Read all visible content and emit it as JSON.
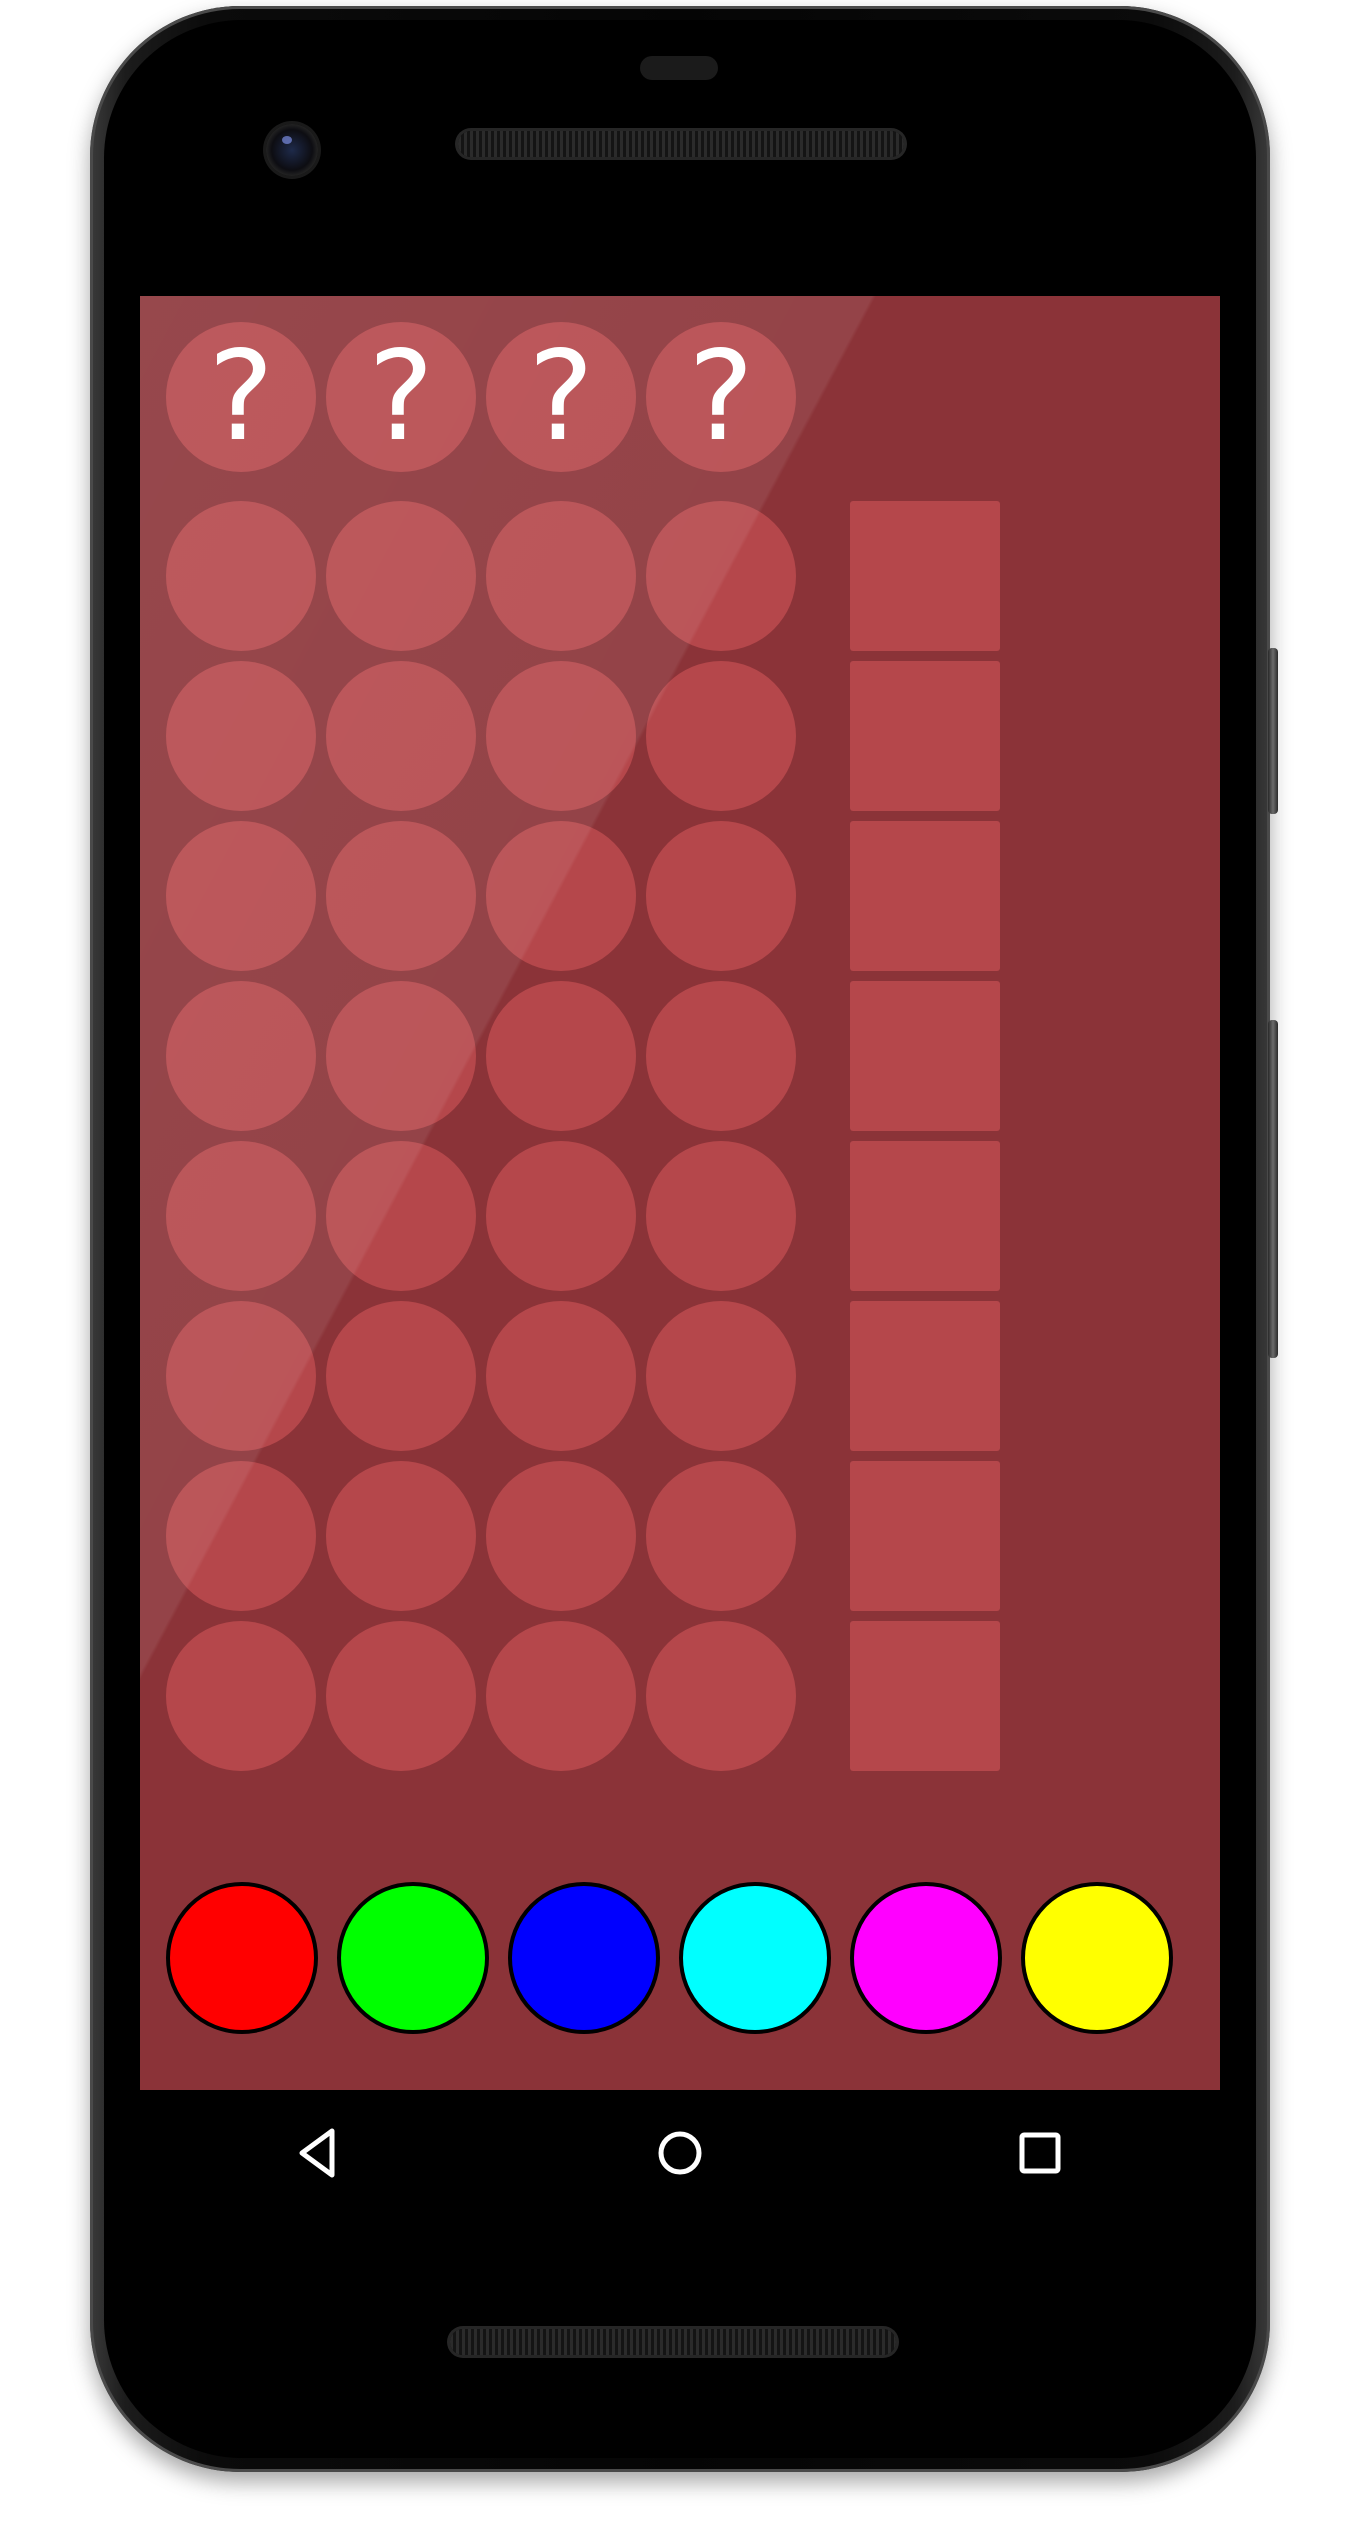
{
  "secret": {
    "slots": [
      "?",
      "?",
      "?",
      "?"
    ]
  },
  "board": {
    "rows": [
      {
        "pegs": [
          "",
          "",
          "",
          ""
        ]
      },
      {
        "pegs": [
          "",
          "",
          "",
          ""
        ]
      },
      {
        "pegs": [
          "",
          "",
          "",
          ""
        ]
      },
      {
        "pegs": [
          "",
          "",
          "",
          ""
        ]
      },
      {
        "pegs": [
          "",
          "",
          "",
          ""
        ]
      },
      {
        "pegs": [
          "",
          "",
          "",
          ""
        ]
      },
      {
        "pegs": [
          "",
          "",
          "",
          ""
        ]
      },
      {
        "pegs": [
          "",
          "",
          "",
          ""
        ]
      }
    ]
  },
  "palette": {
    "colors": [
      {
        "name": "red",
        "hex": "#ff0000"
      },
      {
        "name": "green",
        "hex": "#00ff00"
      },
      {
        "name": "blue",
        "hex": "#0000ff"
      },
      {
        "name": "cyan",
        "hex": "#00ffff"
      },
      {
        "name": "magenta",
        "hex": "#ff00ff"
      },
      {
        "name": "yellow",
        "hex": "#ffff00"
      }
    ]
  },
  "theme": {
    "background": "#8b3338",
    "slot": "#b5474b",
    "text": "#ffffff"
  },
  "navigation": {
    "buttons": [
      {
        "name": "back",
        "icon": "triangle-back-icon"
      },
      {
        "name": "home",
        "icon": "circle-home-icon"
      },
      {
        "name": "recents",
        "icon": "square-recents-icon"
      }
    ]
  }
}
